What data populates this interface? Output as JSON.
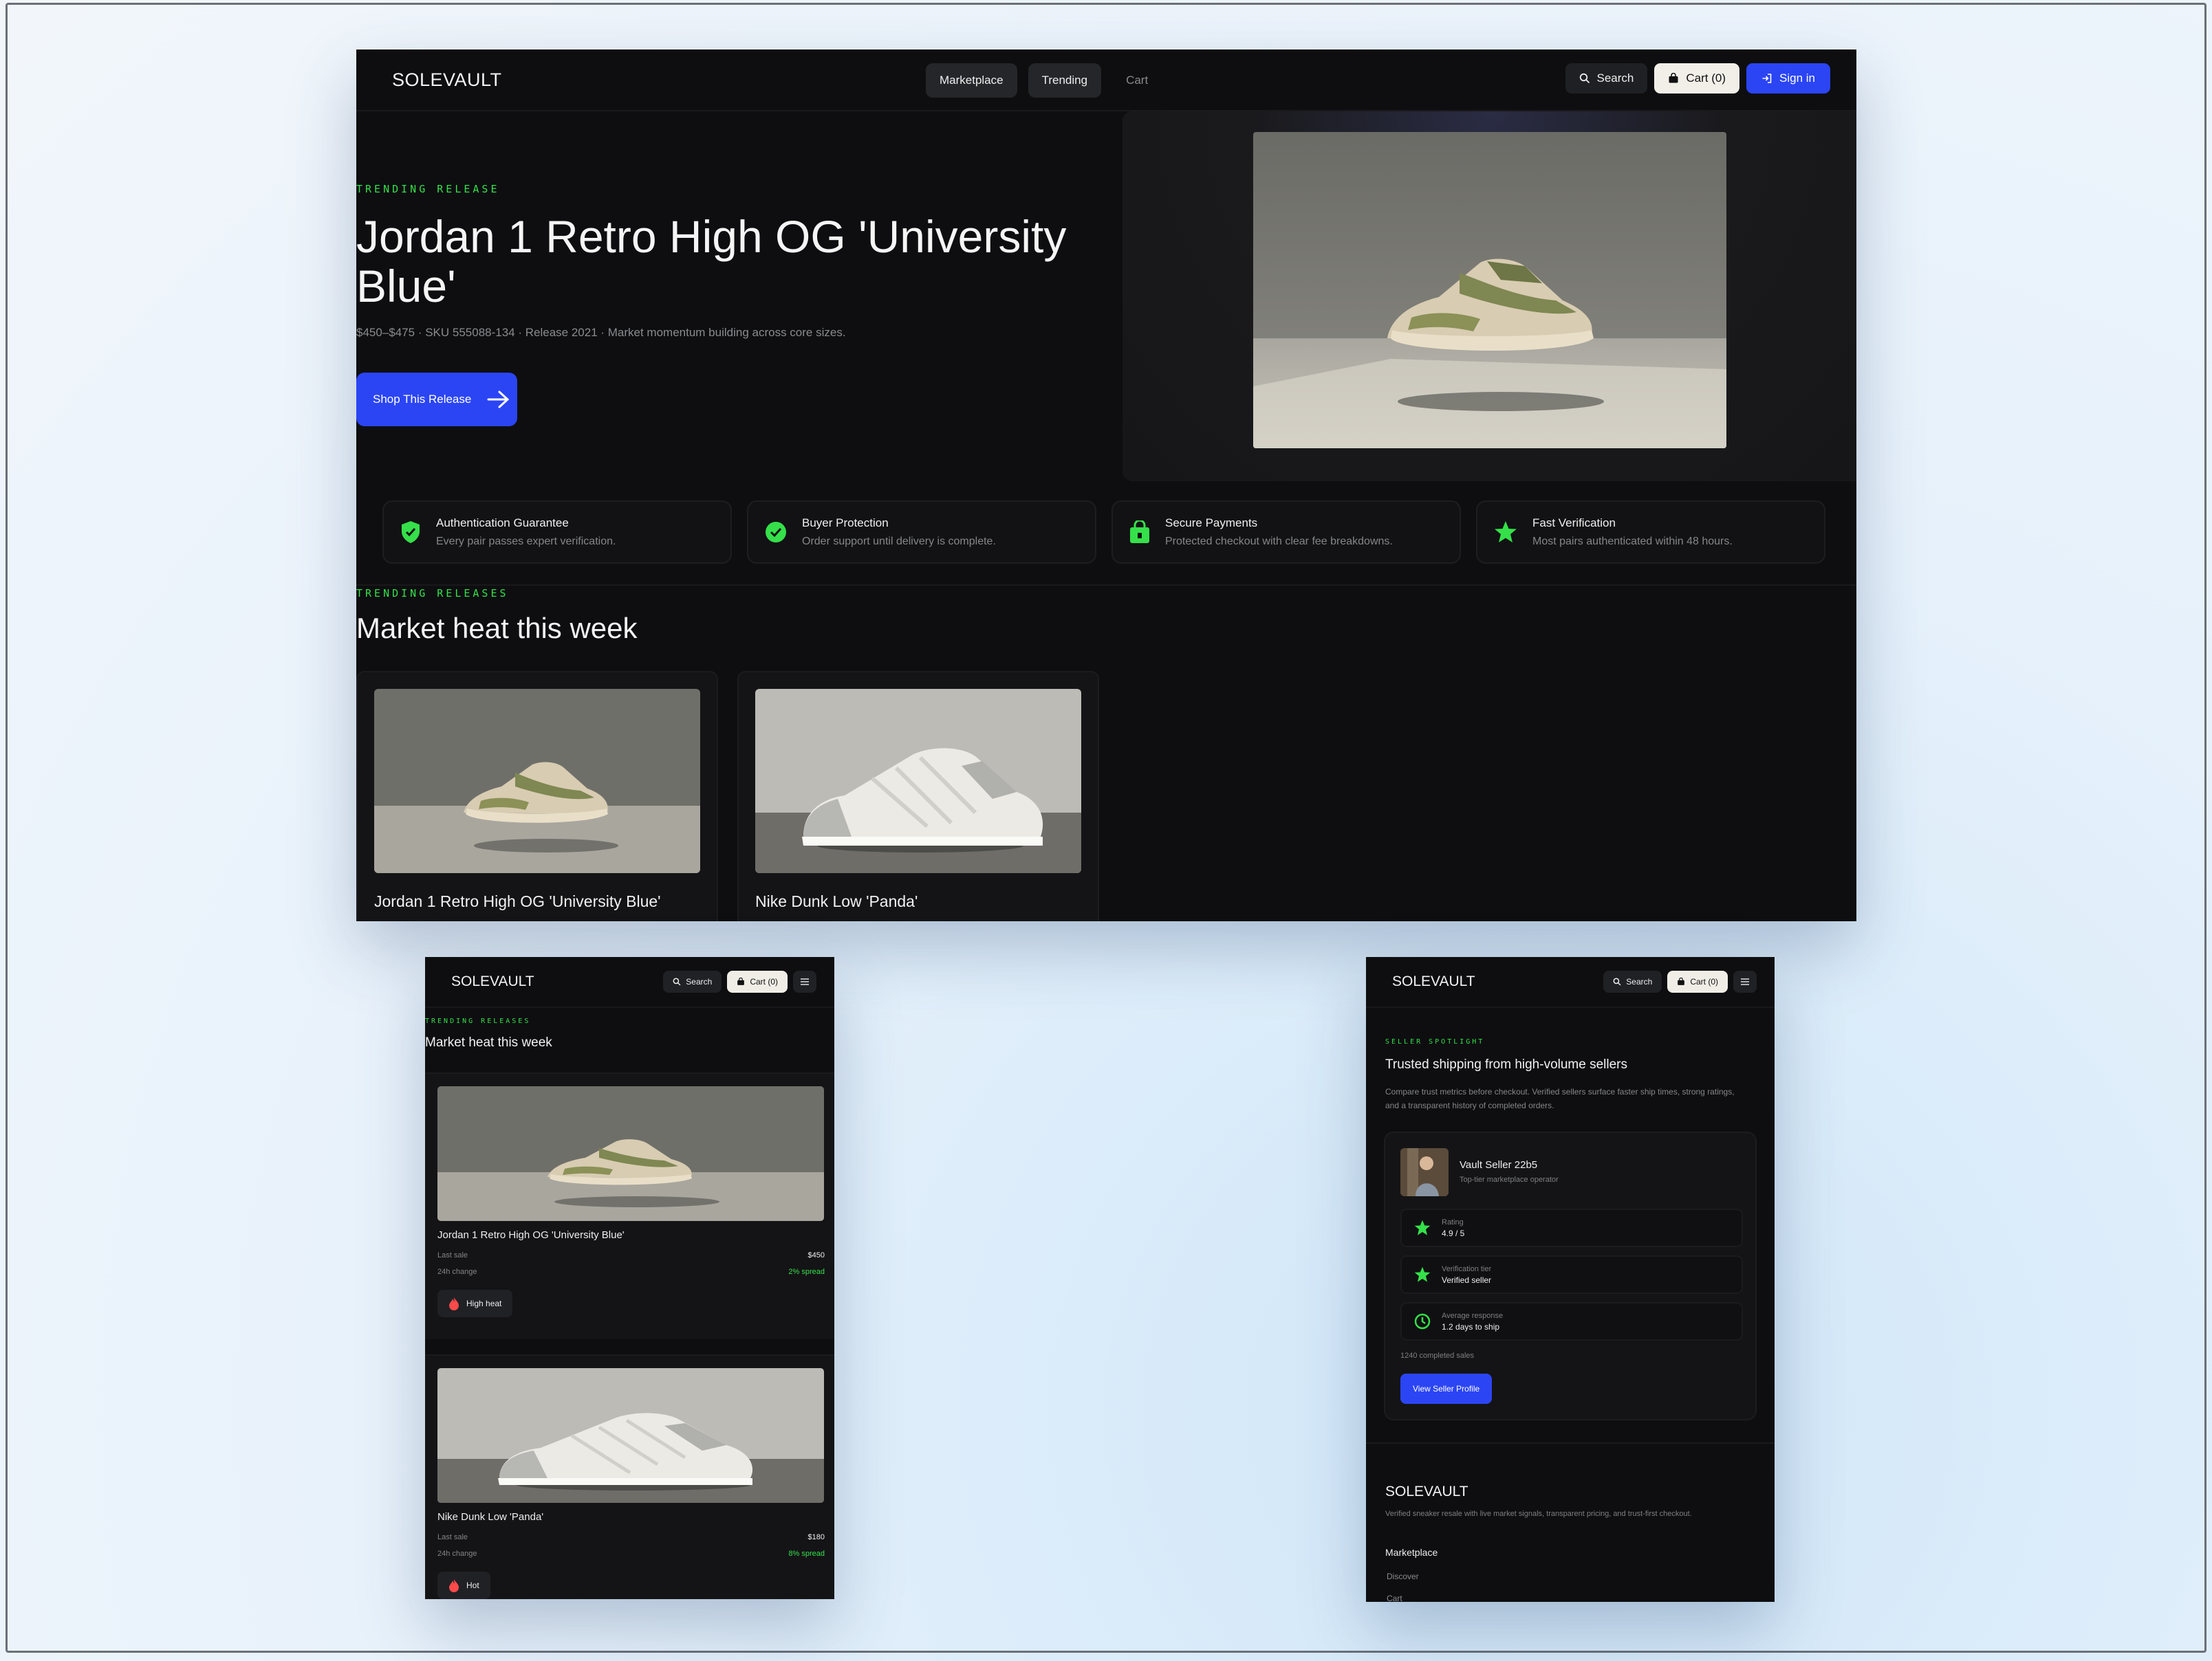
{
  "brand": "SOLEVAULT",
  "nav": {
    "links": [
      "Marketplace",
      "Trending",
      "Cart"
    ],
    "search": "Search",
    "cart": "Cart (0)",
    "signin": "Sign in"
  },
  "hero": {
    "eyebrow": "TRENDING RELEASE",
    "title": "Jordan 1 Retro High OG 'University Blue'",
    "subtitle": "$450–$475 · SKU 555088-134 · Release 2021 · Market momentum building across core sizes.",
    "cta": "Shop This Release"
  },
  "features": [
    {
      "title": "Authentication Guarantee",
      "desc": "Every pair passes expert verification.",
      "icon": "shield-check-icon"
    },
    {
      "title": "Buyer Protection",
      "desc": "Order support until delivery is complete.",
      "icon": "check-circle-icon"
    },
    {
      "title": "Secure Payments",
      "desc": "Protected checkout with clear fee breakdowns.",
      "icon": "shopping-bag-lock-icon"
    },
    {
      "title": "Fast Verification",
      "desc": "Most pairs authenticated within 48 hours.",
      "icon": "star-icon"
    }
  ],
  "trending": {
    "eyebrow": "TRENDING RELEASES",
    "title": "Market heat this week",
    "cards": [
      {
        "name": "Jordan 1 Retro High OG 'University Blue'",
        "last_sale_label": "Last sale",
        "last_sale": "$450",
        "change_label": "24h change",
        "change": "2% spread",
        "heat": "High heat"
      },
      {
        "name": "Nike Dunk Low 'Panda'",
        "last_sale_label": "Last sale",
        "last_sale": "$180",
        "change_label": "24h change",
        "change": "8% spread",
        "heat": "Hot"
      }
    ]
  },
  "seller": {
    "eyebrow": "SELLER SPOTLIGHT",
    "title": "Trusted shipping from high-volume sellers",
    "desc": "Compare trust metrics before checkout. Verified sellers surface faster ship times, strong ratings, and a transparent history of completed orders.",
    "name": "Vault Seller 22b5",
    "role": "Top-tier marketplace operator",
    "rows": [
      {
        "label": "Rating",
        "value": "4.9 / 5",
        "icon": "star-icon"
      },
      {
        "label": "Verification tier",
        "value": "Verified seller",
        "icon": "star-icon"
      },
      {
        "label": "Average response",
        "value": "1.2 days to ship",
        "icon": "clock-icon"
      }
    ],
    "sales": "1240 completed sales",
    "cta": "View Seller Profile"
  },
  "footer": {
    "brand": "SOLEVAULT",
    "desc": "Verified sneaker resale with live market signals, transparent pricing, and trust-first checkout.",
    "heading": "Marketplace",
    "links": [
      "Discover",
      "Cart"
    ]
  },
  "colors": {
    "accent_blue": "#2b45f5",
    "accent_green": "#35e04a",
    "background": "#0e0e10"
  }
}
